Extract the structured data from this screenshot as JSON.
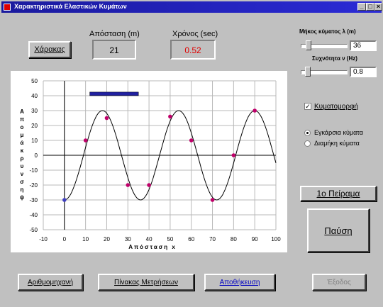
{
  "window": {
    "title": "Χαρακτηριστικά Ελαστικών Κυμάτων",
    "controls": [
      "_",
      "□",
      "×"
    ]
  },
  "buttons": {
    "ruler": "Χάρακας",
    "experiment": "1ο Πείραμα",
    "pause": "Παύση",
    "counter": "Αριθμομηχανή",
    "table": "Πίνακας Μετρήσεων",
    "save": "Αποθήκευση",
    "exit": "Έξοδος"
  },
  "readouts": {
    "distance_label": "Απόσταση (m)",
    "distance_value": "21",
    "time_label": "Χρόνος (sec)",
    "time_value": "0.52"
  },
  "controls": {
    "wavelength_label": "Μήκος κύματος λ (m)",
    "wavelength_value": "36",
    "wavelength_fraction": 0.12,
    "frequency_label": "Συχνότητα ν (Hz)",
    "frequency_value": "0.8",
    "frequency_fraction": 0.1,
    "waveform_label": "Κυματομορφή",
    "waveform_checked": true,
    "transverse_label": "Εγκάρσια κύματα",
    "longitudinal_label": "Διαμήκη κύματα",
    "selected_mode": "transverse"
  },
  "colors": {
    "title_bar": "#1a1a9e",
    "time_value": "#e00000",
    "wave": "#000000",
    "marker": "#c0006a",
    "first_marker": "#4040c0",
    "ruler_bar": "#2020a0",
    "save_text": "#0000c0"
  },
  "chart_data": {
    "type": "line",
    "ylabel": "Απομάκρυνση ψ",
    "xlabel": "Απόσταση x",
    "xlim": [
      -10,
      100
    ],
    "ylim": [
      -50,
      50
    ],
    "xticks": [
      -10,
      0,
      10,
      20,
      30,
      40,
      50,
      60,
      70,
      80,
      90,
      100
    ],
    "yticks": [
      50,
      40,
      30,
      20,
      10,
      0,
      -10,
      -20,
      -30,
      -40,
      -50
    ],
    "wave": {
      "amplitude": 30,
      "wavelength": 36,
      "phase_offset_x": 9
    },
    "markers": [
      {
        "x": 0,
        "y": -30
      },
      {
        "x": 10,
        "y": 10
      },
      {
        "x": 20,
        "y": 25
      },
      {
        "x": 30,
        "y": -20
      },
      {
        "x": 40,
        "y": -20
      },
      {
        "x": 50,
        "y": 26
      },
      {
        "x": 60,
        "y": 10
      },
      {
        "x": 70,
        "y": -30
      },
      {
        "x": 80,
        "y": 0
      },
      {
        "x": 90,
        "y": 30
      }
    ],
    "ruler_bar": {
      "x1": 12,
      "x2": 35,
      "y": 41
    },
    "grid": true
  }
}
